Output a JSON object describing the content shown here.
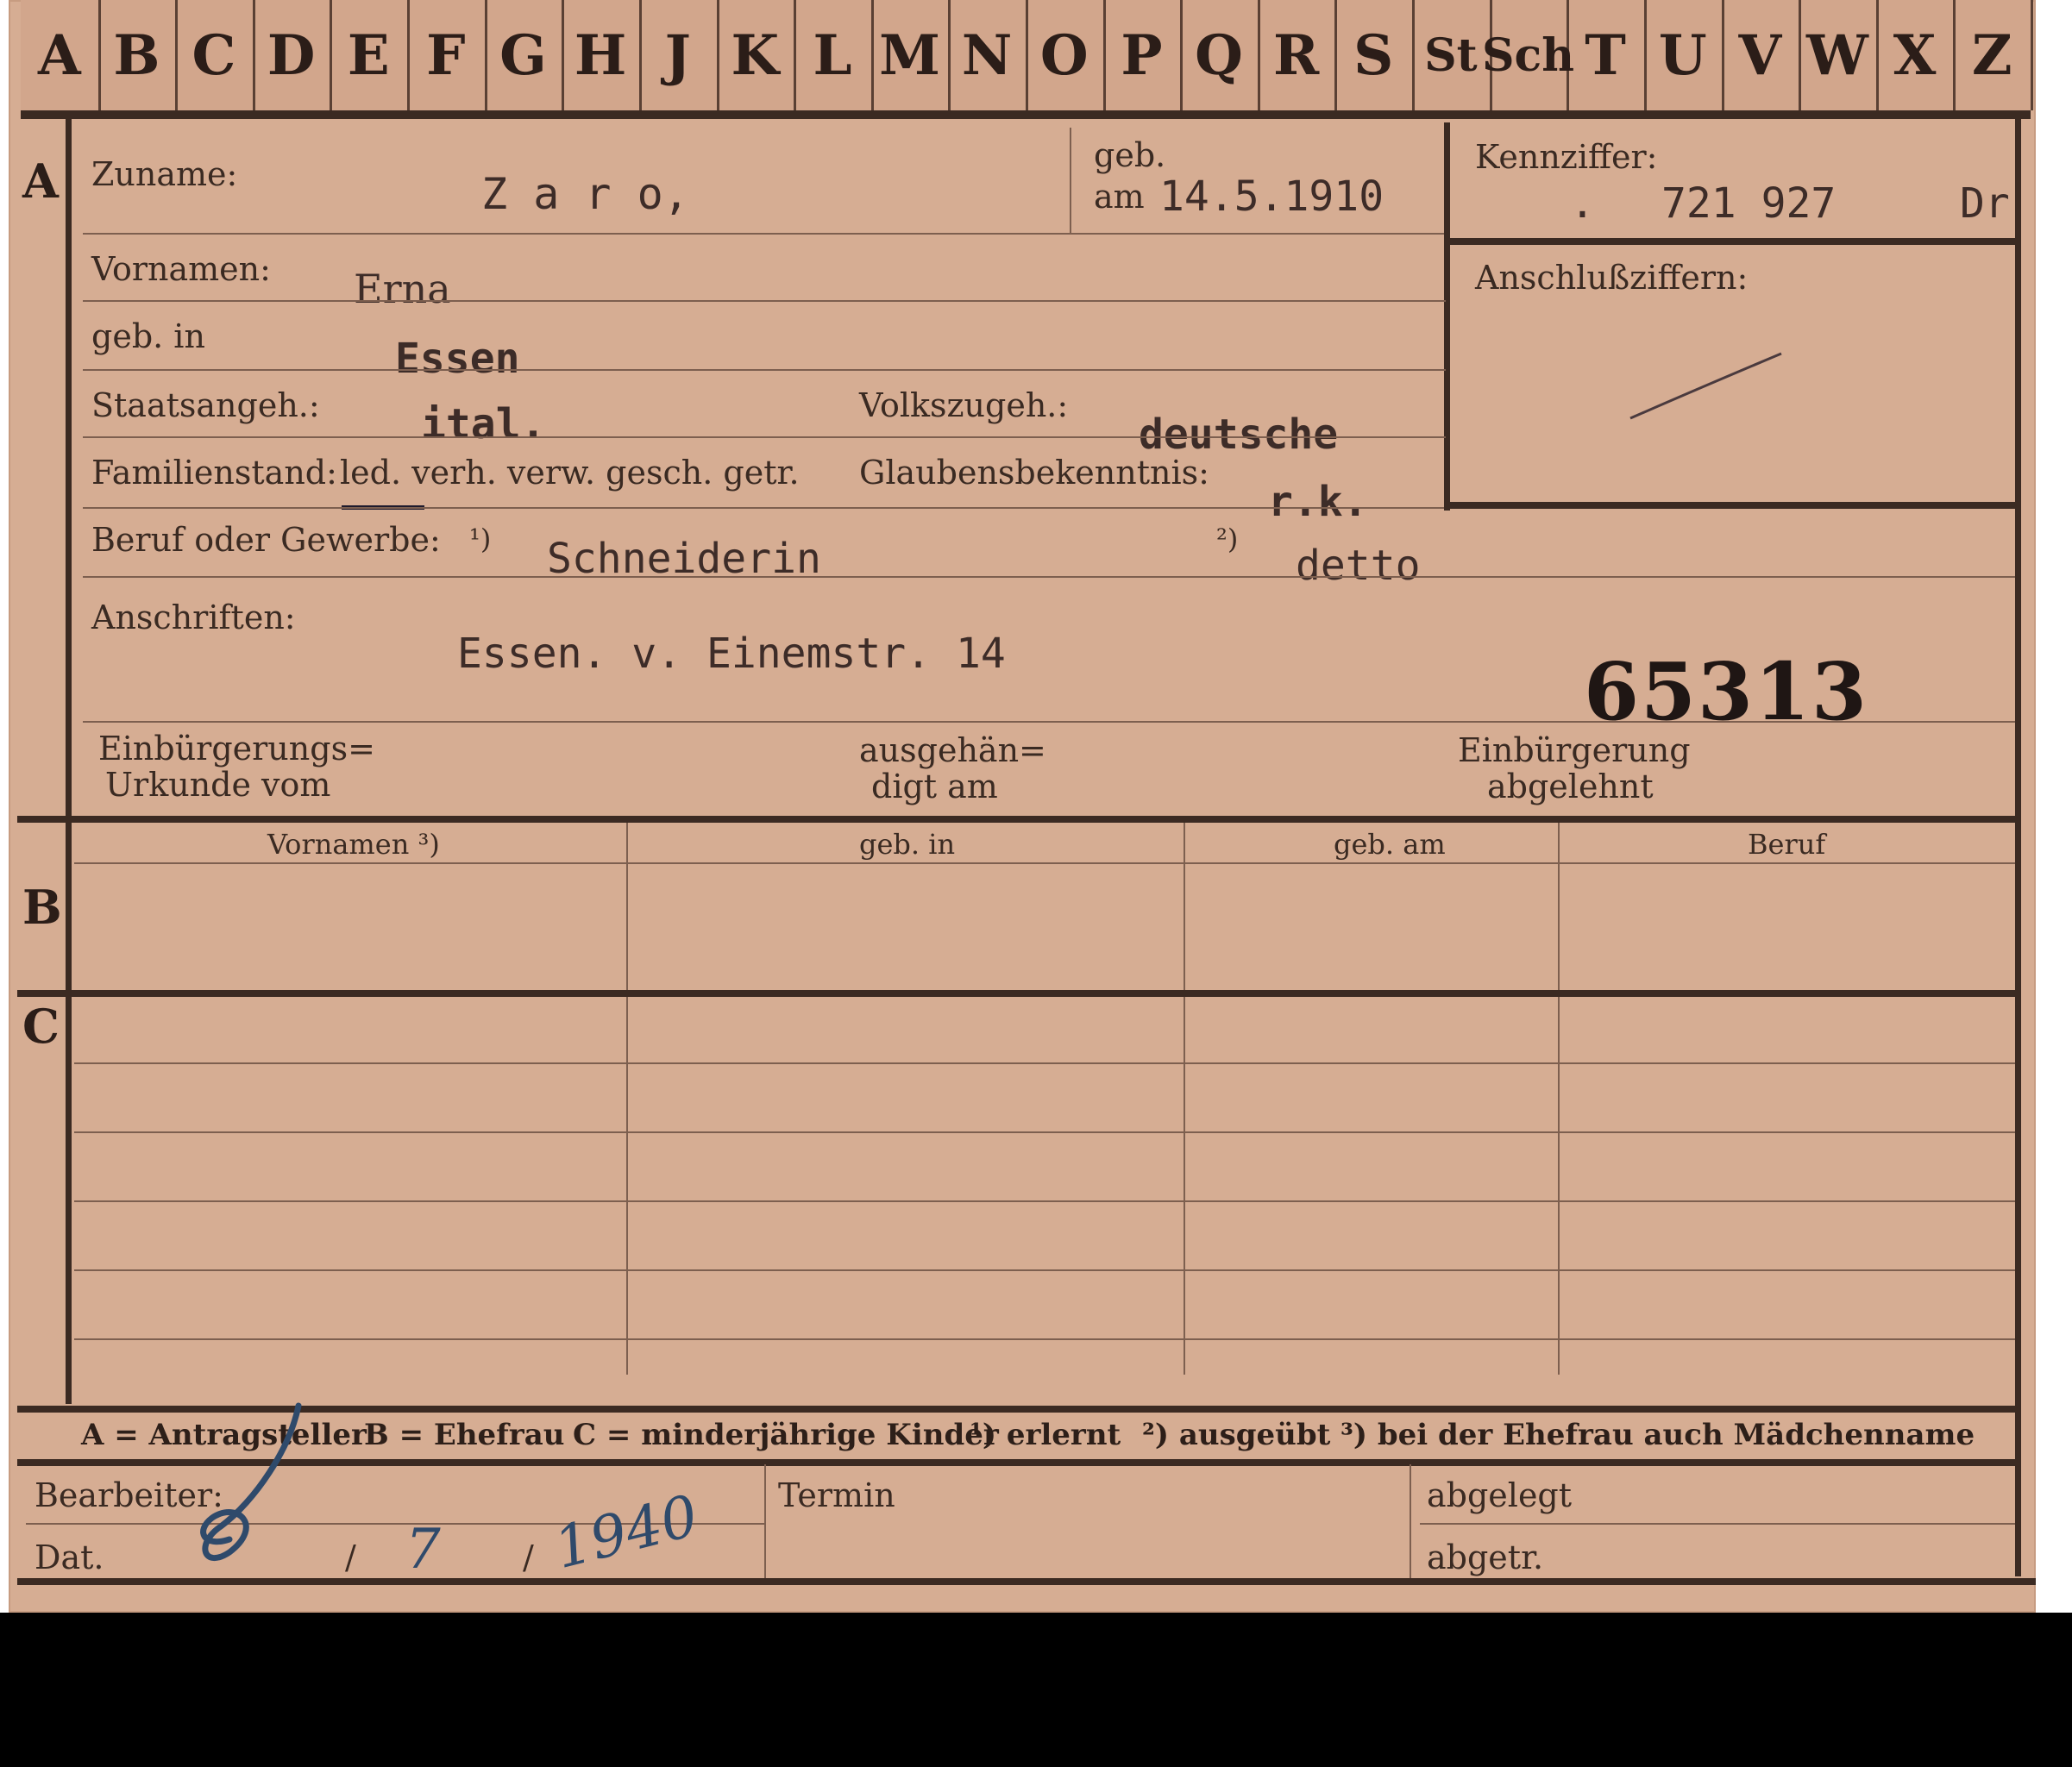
{
  "tabs": [
    "A",
    "B",
    "C",
    "D",
    "E",
    "F",
    "G",
    "H",
    "J",
    "K",
    "L",
    "M",
    "N",
    "O",
    "P",
    "Q",
    "R",
    "S",
    "St",
    "Sch",
    "T",
    "U",
    "V",
    "W",
    "X",
    "Z"
  ],
  "section_a": {
    "letter": "A",
    "zuname_label": "Zuname:",
    "zuname_value": "Z a r o,",
    "geb_label_top": "geb.",
    "geb_am_label": "am",
    "geb_am_value": "14.5.1910",
    "vornamen_label": "Vornamen:",
    "vornamen_value": "Erna",
    "geb_in_label": "geb. in",
    "geb_in_value": "Essen",
    "staatsangeh_label": "Staatsangeh.:",
    "staatsangeh_value": "ital.",
    "volkszugeh_label": "Volkszugeh.:",
    "volkszugeh_value": "deutsche",
    "familienstand_label": "Familienstand:",
    "familienstand_options": "led. verh. verw. gesch. getr.",
    "glaubens_label": "Glaubensbekenntnis:",
    "glaubens_value": "r.k.",
    "beruf_label": "Beruf oder Gewerbe:",
    "beruf_fn1": "¹)",
    "beruf_value1": "Schneiderin",
    "beruf_fn2": "²)",
    "beruf_value2": "detto",
    "anschriften_label": "Anschriften:",
    "anschriften_value": "Essen. v. Einemstr. 14",
    "stamp_number": "65313",
    "einb_urkunde_label_1": "Einbürgerungs=",
    "einb_urkunde_label_2": "Urkunde vom",
    "ausgehaen_label_1": "ausgehän=",
    "ausgehaen_label_2": "digt am",
    "einb_abgelehnt_label_1": "Einbürgerung",
    "einb_abgelehnt_label_2": "abgelehnt"
  },
  "kennziffer": {
    "label": "Kennziffer:",
    "dot": ".",
    "value": "721 927",
    "suffix": "Dr",
    "anschluss_label": "Anschlußziffern:"
  },
  "section_b": {
    "letter": "B",
    "col_vornamen": "Vornamen ³)",
    "col_geb_in": "geb. in",
    "col_geb_am": "geb. am",
    "col_beruf": "Beruf"
  },
  "section_c": {
    "letter": "C"
  },
  "legend": {
    "a": "A = Antragsteller",
    "b": "B = Ehefrau",
    "c": "C = minderjährige Kinder",
    "fn1": "¹) erlernt",
    "fn2": "²) ausgeübt",
    "fn3": "³) bei der Ehefrau auch Mädchenname"
  },
  "footer": {
    "bearbeiter_label": "Bearbeiter:",
    "dat_label": "Dat.",
    "dat_sep1": "/",
    "dat_sep2": "/",
    "dat_month": "7",
    "dat_year": "1940",
    "termin_label": "Termin",
    "abgelegt_label": "abgelegt",
    "abgetr_label": "abgetr."
  },
  "colors": {
    "card": "#d6ad93",
    "ink": "#3a2a22",
    "rule": "#3b2a22",
    "handwriting": "#2f4a6b"
  }
}
